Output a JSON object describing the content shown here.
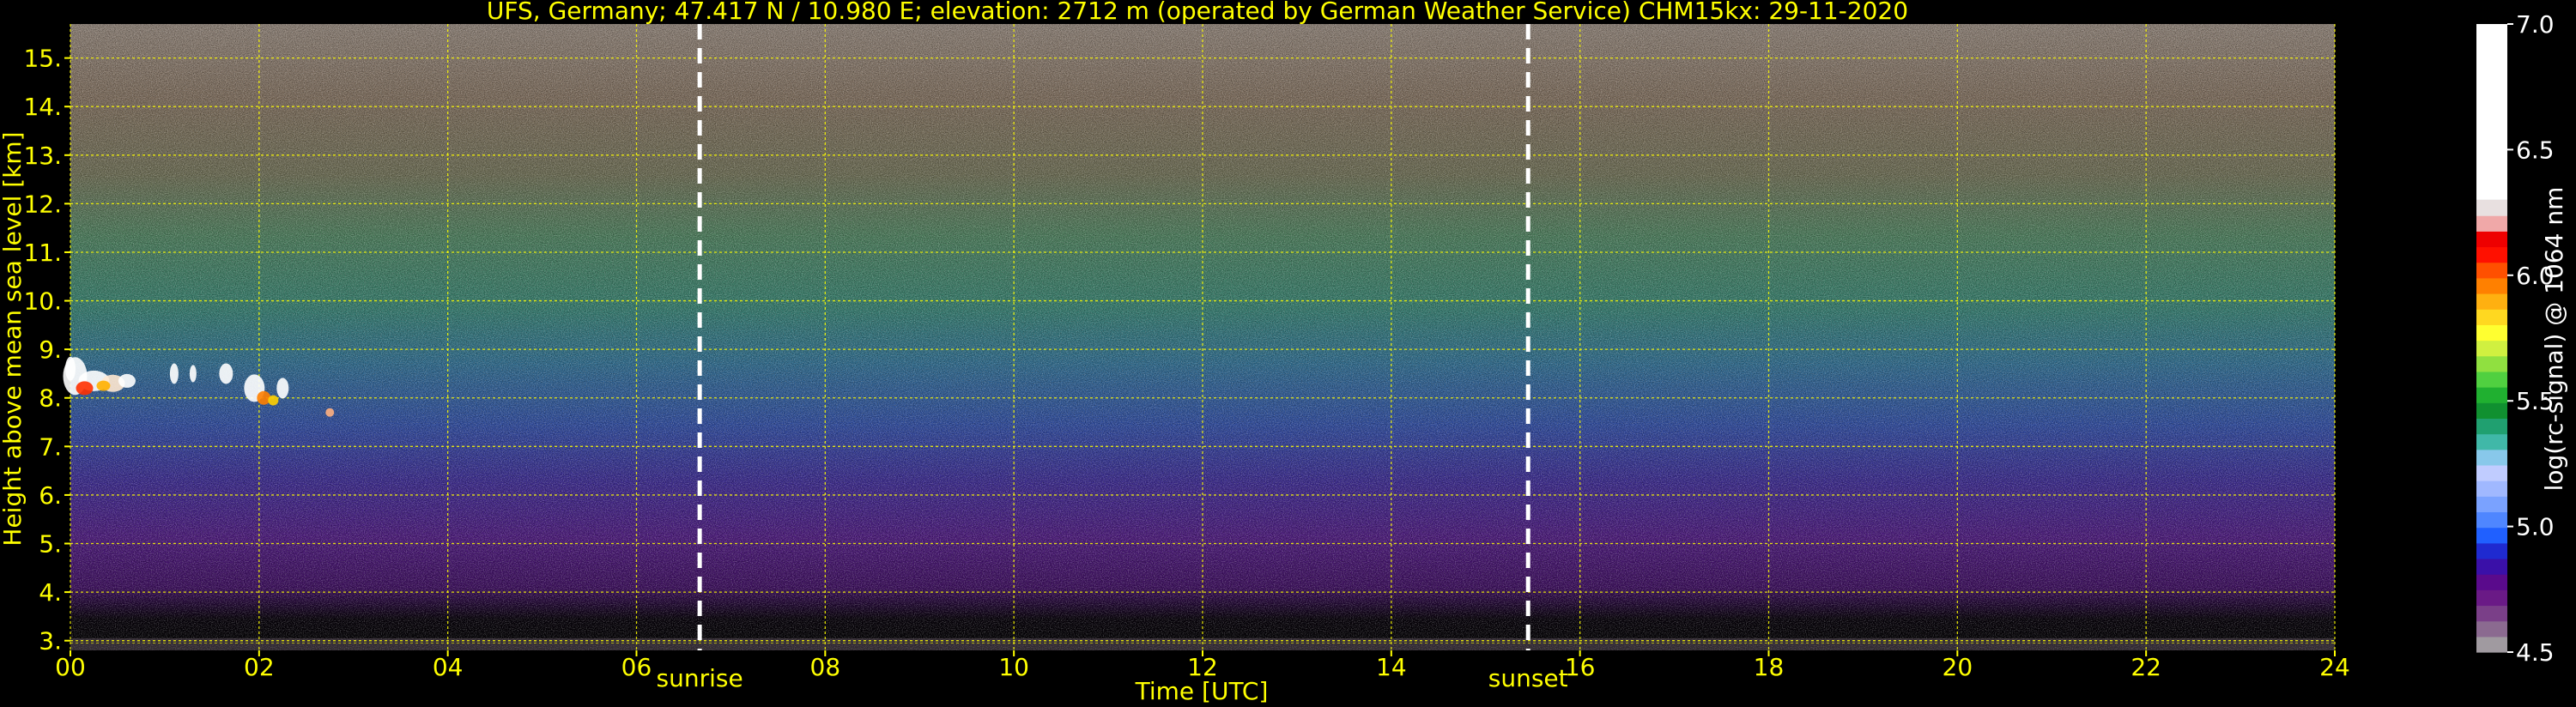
{
  "chart_data": {
    "type": "heatmap",
    "title": "UFS, Germany; 47.417 N / 10.980 E; elevation: 2712 m  (operated by German Weather Service)    CHM15kx: 29-11-2020",
    "xlabel": "Time [UTC]",
    "ylabel": "Height above mean sea level [km]",
    "xlim": [
      0,
      24
    ],
    "ylim": [
      2.8,
      15.7
    ],
    "x_ticks": [
      "00",
      "02",
      "04",
      "06",
      "08",
      "10",
      "12",
      "14",
      "16",
      "18",
      "20",
      "22",
      "24"
    ],
    "y_ticks": [
      "3.",
      "4.",
      "5.",
      "6.",
      "7.",
      "8.",
      "9.",
      "10.",
      "11.",
      "12.",
      "13.",
      "14.",
      "15."
    ],
    "grid": true,
    "grid_color": "#ffff00",
    "text_color": "#ffff00",
    "annotations": [
      {
        "label": "sunrise",
        "x": 6.67
      },
      {
        "label": "sunset",
        "x": 15.45
      }
    ],
    "colorbar": {
      "label": "log(rc-signal) @ 1064 nm",
      "range": [
        4.5,
        7.0
      ],
      "ticks": [
        "4.5",
        "5.0",
        "5.5",
        "6.0",
        "6.5",
        "7.0"
      ],
      "colors": [
        "#a09aa0",
        "#8b6a90",
        "#7a3f88",
        "#6a1a86",
        "#5a0a8c",
        "#3a10a8",
        "#1f2ad0",
        "#2060ff",
        "#4f86ff",
        "#7aa2ff",
        "#a0b8ff",
        "#c0ccff",
        "#88c8ea",
        "#40b8a8",
        "#20a070",
        "#109030",
        "#20b030",
        "#50d040",
        "#90e040",
        "#d0f040",
        "#ffff30",
        "#ffd820",
        "#ffb010",
        "#ff8000",
        "#ff5000",
        "#ff1000",
        "#ee0000",
        "#f0a8a8",
        "#e8e0e0",
        "#ffffff"
      ]
    },
    "features": [
      {
        "type": "cloud",
        "x_range": [
          0.0,
          2.8
        ],
        "height_km": [
          7.6,
          8.9
        ]
      }
    ],
    "background_signal_bands": [
      {
        "height_km": [
          2.8,
          3.5
        ],
        "color": "#000000"
      },
      {
        "height_km": [
          3.5,
          5.5
        ],
        "color": "#5a1a80"
      },
      {
        "height_km": [
          5.5,
          8.5
        ],
        "color": "#3050a0"
      },
      {
        "height_km": [
          8.5,
          11.0
        ],
        "color": "#40906a"
      },
      {
        "height_km": [
          11.0,
          13.5
        ],
        "color": "#806850"
      },
      {
        "height_km": [
          13.5,
          15.7
        ],
        "color": "#a09080"
      }
    ]
  }
}
